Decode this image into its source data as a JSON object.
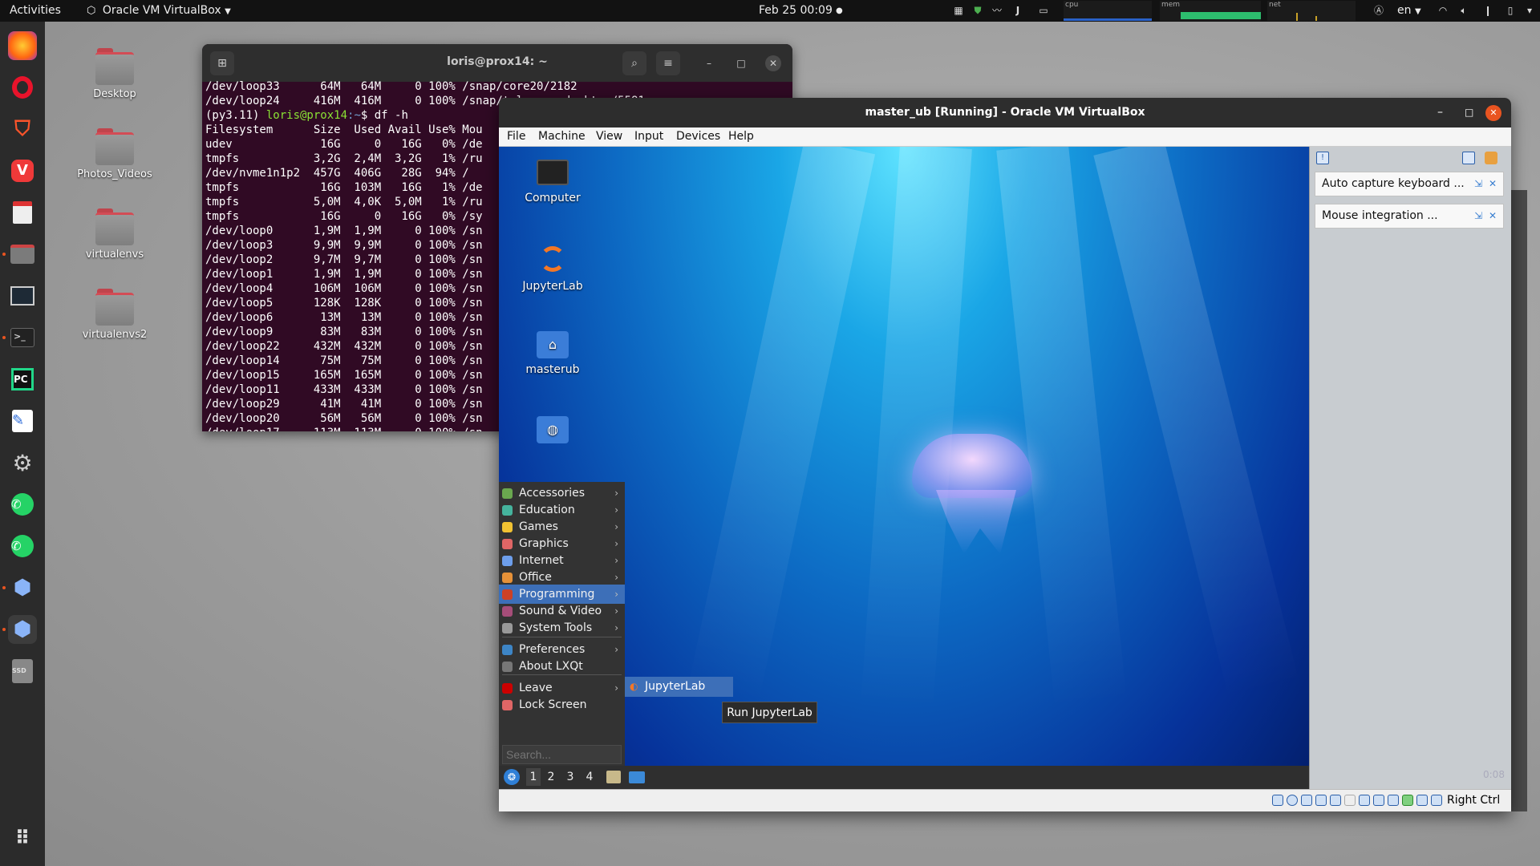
{
  "topbar": {
    "activities": "Activities",
    "app_name": "Oracle VM VirtualBox",
    "datetime": "Feb 25  00:09",
    "graph_labels": {
      "cpu": "cpu",
      "mem": "mem",
      "net": "net"
    },
    "lang": "en"
  },
  "dock": {
    "items": [
      "firefox-icon",
      "opera-icon",
      "brave-icon",
      "vivaldi-icon",
      "document-viewer-icon",
      "files-icon",
      "screenshot-icon",
      "terminal-icon",
      "pycharm-icon",
      "text-editor-icon",
      "settings-icon",
      "whatsapp-icon",
      "whatsapp-alt-icon",
      "virtualbox-icon",
      "virtualbox-active-icon",
      "disk-icon",
      "app-grid-icon"
    ],
    "pycharm_label": "PC",
    "disk_label": "SSD"
  },
  "desktop": {
    "icons": [
      "Desktop",
      "Photos_Videos",
      "virtualenvs",
      "virtualenvs2"
    ]
  },
  "terminal": {
    "title": "loris@prox14: ~",
    "lines": [
      {
        "t": "/dev/loop33      64M   64M     0 100% /snap/core20/2182"
      },
      {
        "t": "/dev/loop24     416M  416M     0 100% /snap/telegram-desktop/5581"
      },
      {
        "prompt_env": "(py3.11) ",
        "prompt_user": "loris@prox14",
        "prompt_path": ":~",
        "cmd": "$ df -h"
      },
      {
        "t": "Filesystem      Size  Used Avail Use% Mou"
      },
      {
        "t": "udev             16G     0   16G   0% /de"
      },
      {
        "t": "tmpfs           3,2G  2,4M  3,2G   1% /ru"
      },
      {
        "t": "/dev/nvme1n1p2  457G  406G   28G  94% /"
      },
      {
        "t": "tmpfs            16G  103M   16G   1% /de"
      },
      {
        "t": "tmpfs           5,0M  4,0K  5,0M   1% /ru"
      },
      {
        "t": "tmpfs            16G     0   16G   0% /sy"
      },
      {
        "t": "/dev/loop0      1,9M  1,9M     0 100% /sn"
      },
      {
        "t": "/dev/loop3      9,9M  9,9M     0 100% /sn"
      },
      {
        "t": "/dev/loop2      9,7M  9,7M     0 100% /sn"
      },
      {
        "t": "/dev/loop1      1,9M  1,9M     0 100% /sn"
      },
      {
        "t": "/dev/loop4      106M  106M     0 100% /sn"
      },
      {
        "t": "/dev/loop5      128K  128K     0 100% /sn"
      },
      {
        "t": "/dev/loop6       13M   13M     0 100% /sn"
      },
      {
        "t": "/dev/loop9       83M   83M     0 100% /sn"
      },
      {
        "t": "/dev/loop22     432M  432M     0 100% /sn"
      },
      {
        "t": "/dev/loop14      75M   75M     0 100% /sn"
      },
      {
        "t": "/dev/loop15     165M  165M     0 100% /sn"
      },
      {
        "t": "/dev/loop11     433M  433M     0 100% /sn"
      },
      {
        "t": "/dev/loop29      41M   41M     0 100% /sn"
      },
      {
        "t": "/dev/loop20      56M   56M     0 100% /sn"
      },
      {
        "t": "/dev/loop17     113M  113M     0 100% /sn"
      }
    ]
  },
  "vbox": {
    "title": "master_ub [Running] - Oracle VM VirtualBox",
    "menu": [
      "File",
      "Machine",
      "View",
      "Input",
      "Devices",
      "Help"
    ],
    "notifications": [
      "Auto capture keyboard ...",
      "Mouse integration ..."
    ],
    "host_key": "Right Ctrl"
  },
  "guest": {
    "desktop_icons": [
      "Computer",
      "JupyterLab",
      "masterub"
    ],
    "menu": {
      "items": [
        {
          "label": "Accessories",
          "color": "#6aa84f",
          "sub": true
        },
        {
          "label": "Education",
          "color": "#45b39d",
          "sub": true
        },
        {
          "label": "Games",
          "color": "#f1c232",
          "sub": true
        },
        {
          "label": "Graphics",
          "color": "#e06666",
          "sub": true
        },
        {
          "label": "Internet",
          "color": "#6d9eeb",
          "sub": true
        },
        {
          "label": "Office",
          "color": "#e69138",
          "sub": true
        },
        {
          "label": "Programming",
          "color": "#cc4125",
          "sub": true
        },
        {
          "label": "Sound & Video",
          "color": "#a64d79",
          "sub": true
        },
        {
          "label": "System Tools",
          "color": "#999999",
          "sub": true
        },
        {
          "label": "Preferences",
          "color": "#3d85c6",
          "sub": true
        },
        {
          "label": "About LXQt",
          "color": "#777777",
          "sub": false
        },
        {
          "label": "Leave",
          "color": "#cc0000",
          "sub": true
        },
        {
          "label": "Lock Screen",
          "color": "#e06666",
          "sub": false
        }
      ],
      "search_placeholder": "Search...",
      "submenu_item": "JupyterLab",
      "tooltip": "Run JupyterLab"
    },
    "panel": {
      "workspaces": [
        "1",
        "2",
        "3",
        "4"
      ]
    },
    "clock": "0:08"
  }
}
